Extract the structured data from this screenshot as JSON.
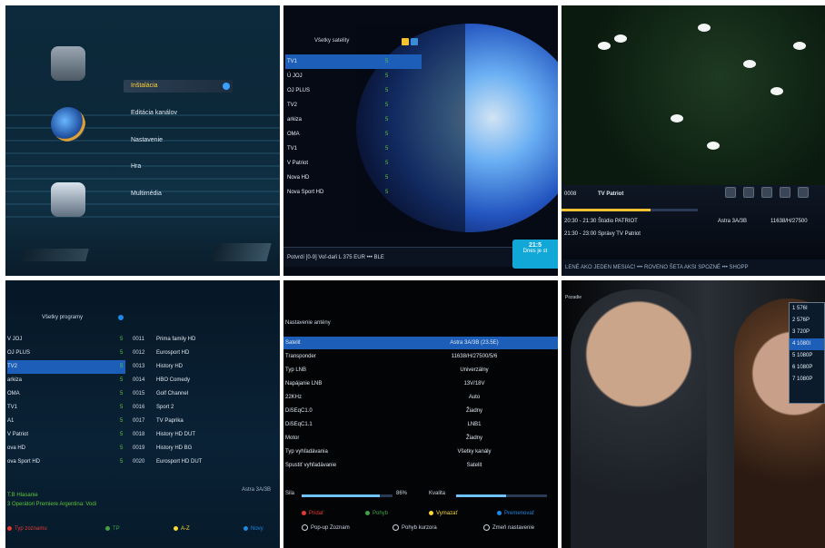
{
  "panel1": {
    "menu_items": [
      {
        "label": "Inštalácia"
      },
      {
        "label": "Editácia kanálov"
      },
      {
        "label": "Nastavenie"
      },
      {
        "label": "Hra"
      },
      {
        "label": "Multimédia"
      }
    ]
  },
  "panel2": {
    "header": "Všetky satelity",
    "channels": [
      {
        "name": "TV1",
        "num": "5"
      },
      {
        "name": "Ú JOJ",
        "num": "5"
      },
      {
        "name": "OJ PLUS",
        "num": "5"
      },
      {
        "name": "TV2",
        "num": "5"
      },
      {
        "name": "arkiza",
        "num": "5"
      },
      {
        "name": "OMA",
        "num": "5"
      },
      {
        "name": "TV1",
        "num": "5"
      },
      {
        "name": "V Patriot",
        "num": "5"
      },
      {
        "name": "Nova HD",
        "num": "5"
      },
      {
        "name": "Nova Sport HD",
        "num": "5"
      }
    ],
    "ticker_text": "Potvrdí   [0-9] Voľ-daŕi   L 375 EUR   •••   BLE",
    "time_box": {
      "time": "21:5",
      "subtext": "Dnes je st"
    }
  },
  "panel3": {
    "channel_no": "0008",
    "channel_name": "TV Patriot",
    "program1": "20:30 - 21:30  Štúdio PATRIOT",
    "program2": "21:30 - 23:00  Správy TV Patriot",
    "satellite": "Astra 3A/3B",
    "frequency": "11638/H/27500",
    "bottom_ticker": "LENÉ AKO JEDEN MESIAC!   •••   ROVENO ŠETA AKSI SPOZNÉ   •••   SHOPP",
    "progress": 0.65
  },
  "panel4": {
    "header": "Všetky programy",
    "left_rows": [
      {
        "name": "V JOJ",
        "num": "5"
      },
      {
        "name": "OJ PLUS",
        "num": "5"
      },
      {
        "name": "TV2",
        "num": "5"
      },
      {
        "name": "arkiza",
        "num": "5"
      },
      {
        "name": "OMA",
        "num": "5"
      },
      {
        "name": "TV1",
        "num": "5"
      },
      {
        "name": "A1",
        "num": "5"
      },
      {
        "name": "V Patriot",
        "num": "5"
      },
      {
        "name": "ova HD",
        "num": "5"
      },
      {
        "name": "ova Sport HD",
        "num": "5"
      }
    ],
    "right_rows": [
      {
        "code": "0011",
        "name": "Prima family HD"
      },
      {
        "code": "0012",
        "name": "Eurosport HD"
      },
      {
        "code": "0013",
        "name": "History HD"
      },
      {
        "code": "0014",
        "name": "HBO Comedy"
      },
      {
        "code": "0015",
        "name": "Golf Channel"
      },
      {
        "code": "0016",
        "name": "Sport 2"
      },
      {
        "code": "0017",
        "name": "TV Paprika"
      },
      {
        "code": "0018",
        "name": "History HD DUT"
      },
      {
        "code": "0019",
        "name": "History HD BG"
      },
      {
        "code": "0020",
        "name": "Eurosport HD DUT"
      }
    ],
    "status_left1": "T.B Hlasanie",
    "status_left2": "3 Operátori Premiere Argentina: Vodi",
    "status_right": "Astra 3A/3B",
    "footer": [
      {
        "label": "Typ zoznamu",
        "color": "#e53935"
      },
      {
        "label": "TP",
        "color": "#43a047"
      },
      {
        "label": "A-Z",
        "color": "#fdd835"
      },
      {
        "label": "Novy",
        "color": "#1e88e5"
      }
    ]
  },
  "panel5": {
    "title": "Nastavenie antény",
    "rows": [
      {
        "label": "Satelit",
        "value": "Astra 3A/3B (23.5E)"
      },
      {
        "label": "Transponder",
        "value": "11638/H/27500/5/6"
      },
      {
        "label": "Typ LNB",
        "value": "Univerzálny"
      },
      {
        "label": "Napájanie LNB",
        "value": "13V/18V"
      },
      {
        "label": "22KHz",
        "value": "Auto"
      },
      {
        "label": "DiSEqC1.0",
        "value": "Žiadny"
      },
      {
        "label": "DiSEqC1.1",
        "value": "LNB1"
      },
      {
        "label": "Motor",
        "value": "Žiadny"
      },
      {
        "label": "Typ vyhľadávania",
        "value": "Všetky kanály"
      },
      {
        "label": "Spustiť vyhľadávanie",
        "value": "Satelit"
      }
    ],
    "sila_label": "Sila",
    "sila_percent": "86%",
    "sila_value": 0.86,
    "kvalita_label": "Kvalita",
    "kvalita_value": 0.55,
    "colored_buttons": [
      {
        "label": "Pridať",
        "color": "#e53935"
      },
      {
        "label": "Pohyb",
        "color": "#43a047"
      },
      {
        "label": "Vymazať",
        "color": "#fdd835"
      },
      {
        "label": "Premenovať",
        "color": "#1e88e5"
      }
    ],
    "help_items": [
      {
        "label": "Pop-up Zoznam"
      },
      {
        "label": "Pohyb kurzora"
      },
      {
        "label": "Zmeň nastavenie"
      }
    ]
  },
  "panel6": {
    "mini_label": "Pozadie",
    "resolutions": [
      {
        "label": "1  576I"
      },
      {
        "label": "2  576P"
      },
      {
        "label": "3  720P"
      },
      {
        "label": "4  1080I"
      },
      {
        "label": "5  1080P"
      },
      {
        "label": "6  1080P"
      },
      {
        "label": "7  1080P"
      }
    ],
    "selected_index": 3
  }
}
